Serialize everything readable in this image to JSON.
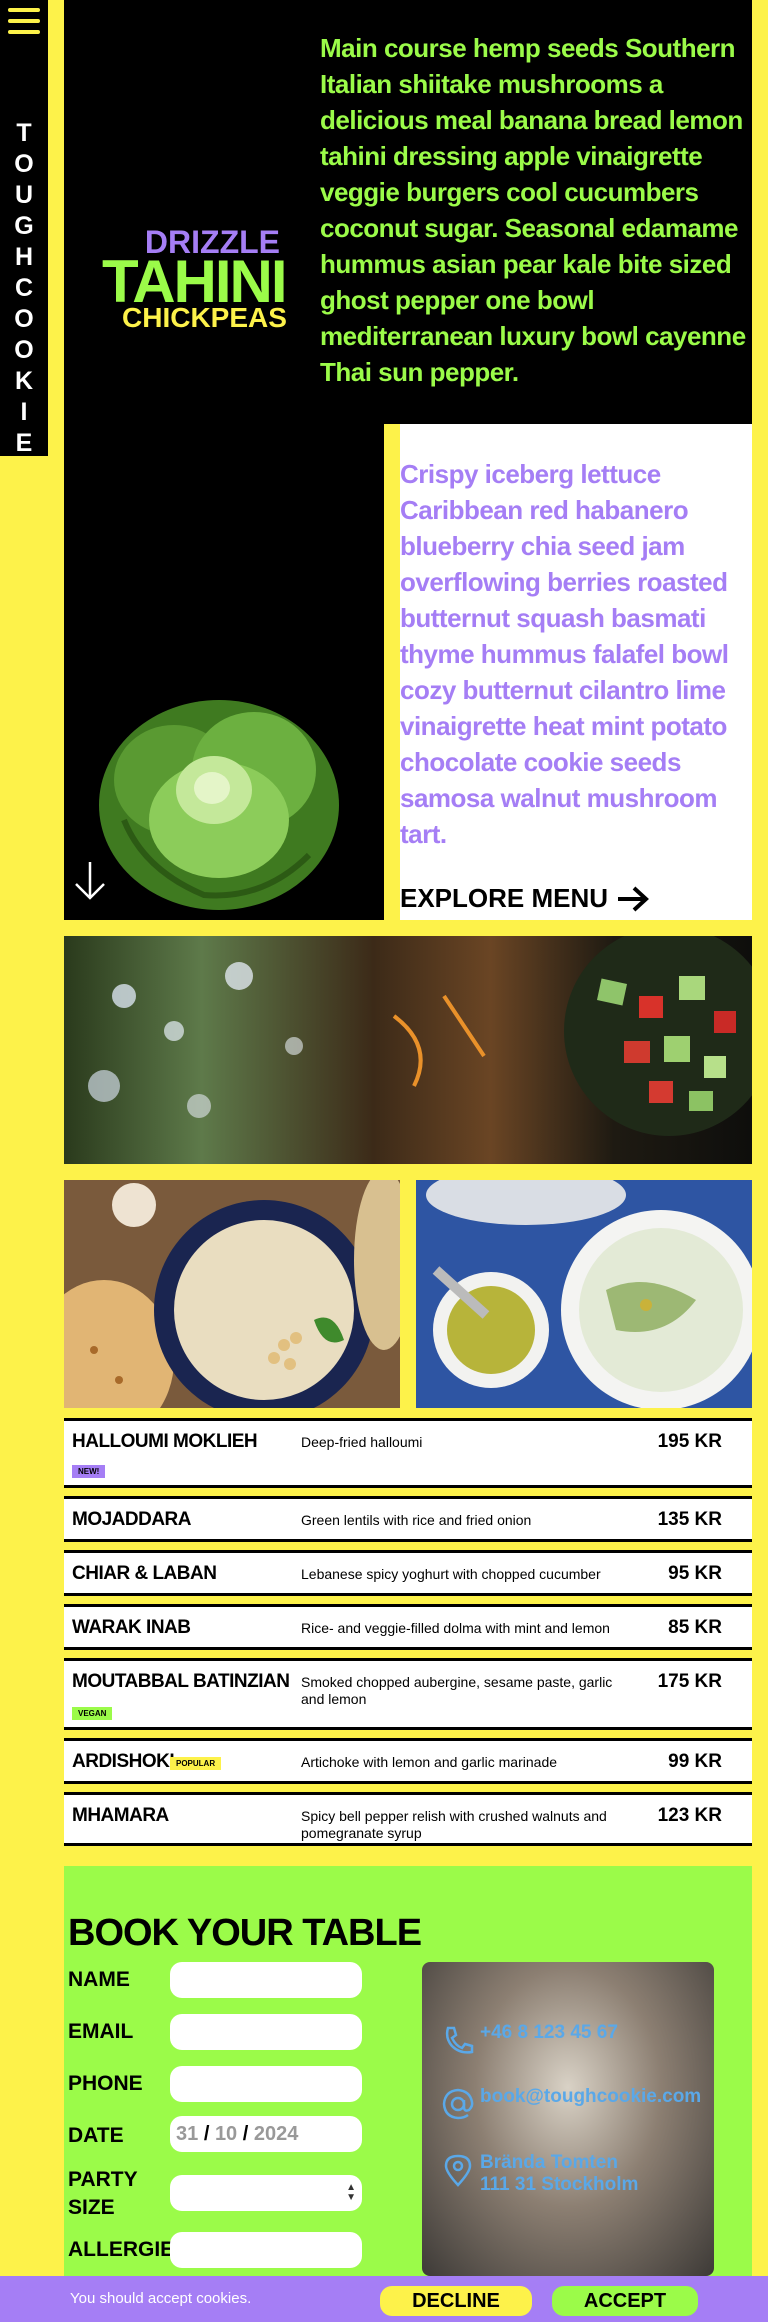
{
  "sidebar": {
    "brand_letters": [
      "T",
      "O",
      "U",
      "G",
      "H",
      "C",
      "O",
      "O",
      "K",
      "I",
      "E"
    ]
  },
  "hero": {
    "text": "Main course hemp seeds Southern Italian shiitake mushrooms a delicious meal banana bread lemon tahini dressing apple vinaigrette veggie burgers cool cucumbers coconut sugar. Seasonal edamame hummus asian pear kale bite sized ghost pepper one bowl mediterranean luxury bowl cayenne Thai sun pepper.",
    "logo": {
      "line1": "DRIZZLE",
      "line2": "TAHINI",
      "line3": "CHICKPEAS"
    }
  },
  "intro": {
    "text": "Crispy iceberg lettuce Caribbean red habanero blueberry chia seed jam overflowing berries roasted butternut squash basmati thyme hummus falafel bowl cozy butternut cilantro lime vinaigrette heat mint potato chocolate cookie seeds samosa walnut mushroom tart.",
    "explore": "EXPLORE MENU"
  },
  "menu": {
    "items": [
      {
        "name": "HALLOUMI MOKLIEH",
        "desc": "Deep-fried halloumi",
        "price": "195 KR",
        "badge": "NEW!"
      },
      {
        "name": "MOJADDARA",
        "desc": "Green lentils with rice and fried onion",
        "price": "135 KR"
      },
      {
        "name": "CHIAR & LABAN",
        "desc": "Lebanese spicy yoghurt with chopped cucumber",
        "price": "95 KR"
      },
      {
        "name": "WARAK INAB",
        "desc": "Rice- and veggie-filled dolma with mint and lemon",
        "price": "85 KR"
      },
      {
        "name": "MOUTABBAL BATINZIAN",
        "desc": "Smoked chopped aubergine, sesame paste, garlic and lemon",
        "price": "175 KR",
        "badge": "VEGAN"
      },
      {
        "name": "ARDISHOKI",
        "desc": "Artichoke with lemon and garlic marinade",
        "price": "99 KR",
        "badge": "POPULAR"
      },
      {
        "name": "MHAMARA",
        "desc": "Spicy bell pepper relish with crushed walnuts and pomegranate syrup",
        "price": "123 KR"
      }
    ]
  },
  "booking": {
    "title": "BOOK YOUR TABLE",
    "labels": {
      "name": "NAME",
      "email": "EMAIL",
      "phone": "PHONE",
      "date": "DATE",
      "party_1": "PARTY",
      "party_2": "SIZE",
      "allergies": "ALLERGIES"
    },
    "date": {
      "day": "31",
      "month": "10",
      "year": "2024",
      "sep": "/"
    }
  },
  "contact": {
    "phone": "+46 8 123 45 67",
    "email": "book@toughcookie.com",
    "address_1": "Brända Tomten",
    "address_2": "111 31 Stockholm"
  },
  "cookie": {
    "text": "You should accept cookies.",
    "decline": "DECLINE",
    "accept": "ACCEPT"
  },
  "colors": {
    "yellow": "#fdf24a",
    "green": "#9bfb49",
    "purple": "#a57ef5",
    "black": "#000000",
    "contact_blue": "#5aa8e8"
  }
}
